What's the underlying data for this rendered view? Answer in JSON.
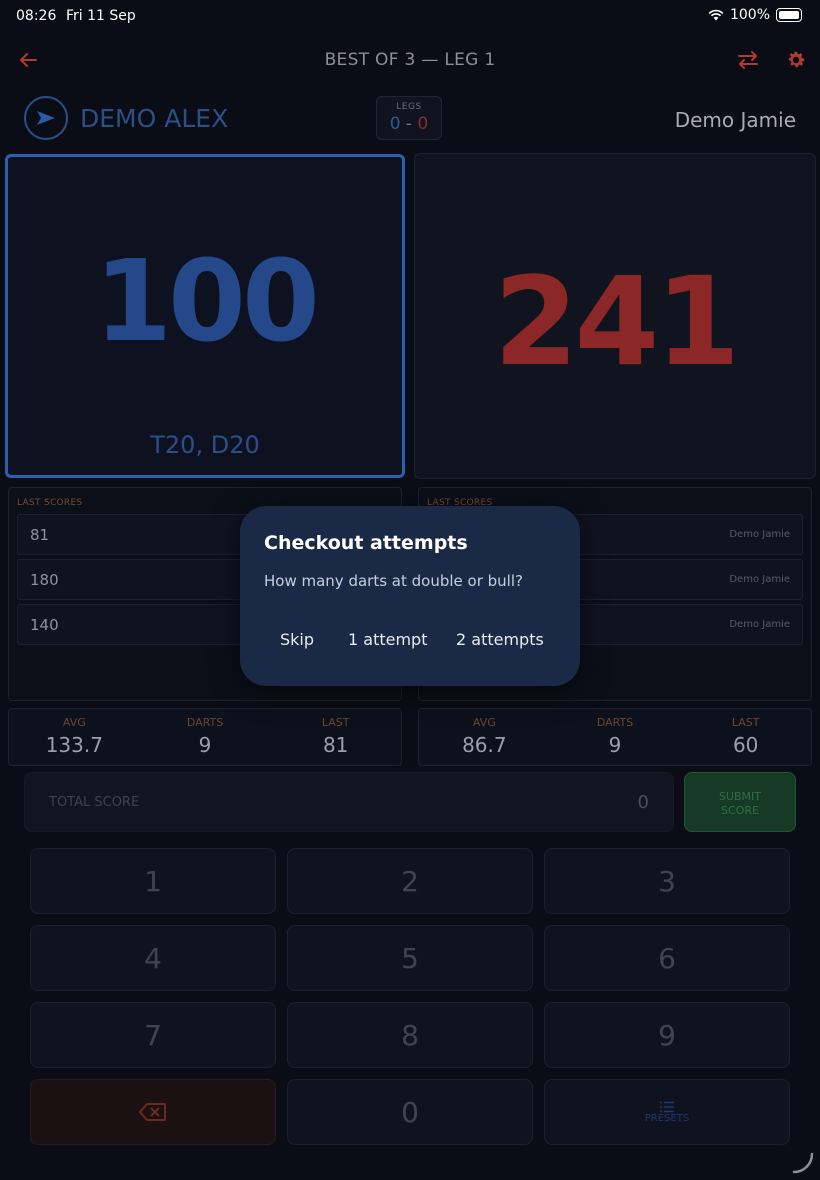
{
  "status_bar": {
    "time": "08:26",
    "date": "Fri 11 Sep",
    "battery": "100%"
  },
  "header": {
    "title": "BEST OF 3 — LEG 1"
  },
  "players": {
    "left": {
      "name": "DEMO ALEX",
      "score": "100",
      "checkout": "T20, D20"
    },
    "right": {
      "name": "Demo Jamie",
      "score": "241"
    }
  },
  "legs": {
    "label": "LEGS",
    "left": "0",
    "separator": "-",
    "right": "0"
  },
  "last_scores": {
    "title": "LAST SCORES",
    "left": [
      "81",
      "180",
      "140"
    ],
    "right_name": "Demo Jamie"
  },
  "stats": {
    "labels": {
      "avg": "AVG",
      "darts": "DARTS",
      "last": "LAST"
    },
    "left": {
      "avg": "133.7",
      "darts": "9",
      "last": "81"
    },
    "right": {
      "avg": "86.7",
      "darts": "9",
      "last": "60"
    }
  },
  "input": {
    "placeholder": "TOTAL SCORE",
    "value": "0",
    "submit_line1": "SUBMIT",
    "submit_line2": "SCORE"
  },
  "keypad": {
    "keys": [
      "1",
      "2",
      "3",
      "4",
      "5",
      "6",
      "7",
      "8",
      "9"
    ],
    "zero": "0",
    "presets": "PRESETS"
  },
  "dialog": {
    "title": "Checkout attempts",
    "message": "How many darts at double or bull?",
    "buttons": {
      "skip": "Skip",
      "one": "1 attempt",
      "two": "2 attempts"
    }
  },
  "colors": {
    "blue": "#2c5fae",
    "red": "#8c2727",
    "accent_orange": "#c0392b",
    "dialog_bg": "#1a2946"
  }
}
